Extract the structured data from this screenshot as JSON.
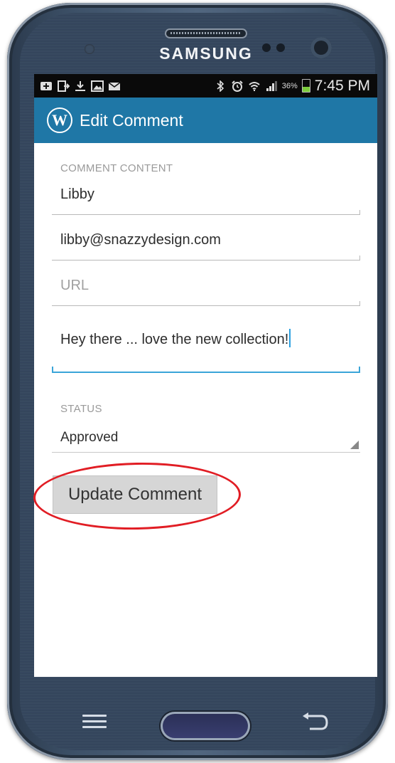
{
  "device": {
    "brand": "SAMSUNG"
  },
  "status_bar": {
    "battery_percent": "36%",
    "time": "7:45 PM"
  },
  "action_bar": {
    "title": "Edit Comment",
    "app_icon": "wordpress-logo"
  },
  "form": {
    "section_label": "COMMENT CONTENT",
    "author_name": "Libby",
    "author_email": "libby@snazzydesign.com",
    "url_placeholder": "URL",
    "url_value": "",
    "comment_text": "Hey there  ... love the new collection!",
    "status_label": "STATUS",
    "status_value": "Approved"
  },
  "actions": {
    "update_label": "Update Comment"
  },
  "colors": {
    "action_bar": "#1f77a6",
    "focus_accent": "#3aa5d8",
    "annotation": "#e11d24"
  }
}
